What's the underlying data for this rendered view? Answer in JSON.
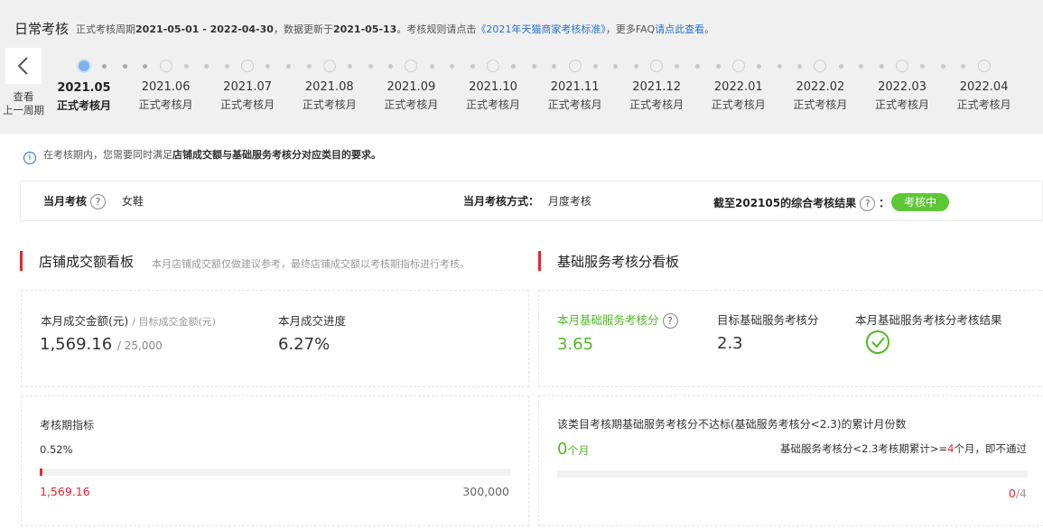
{
  "header": {
    "title": "日常考核",
    "period_prefix": "正式考核周期",
    "period": "2021-05-01 - 2022-04-30",
    "updated_prefix": "，数据更新于",
    "updated": "2021-05-13",
    "rule_prefix": "。考核规则请点击",
    "rule_link": "《2021年天猫商家考核标准》",
    "faq_prefix": "，更多FAQ",
    "faq_link": "请点此查看",
    "faq_suffix": "。"
  },
  "back": {
    "label_line1": "查看",
    "label_line2": "上一周期"
  },
  "timeline": {
    "months": [
      {
        "month": "2021.05",
        "status": "正式考核月",
        "active": true
      },
      {
        "month": "2021.06",
        "status": "正式考核月"
      },
      {
        "month": "2021.07",
        "status": "正式考核月"
      },
      {
        "month": "2021.08",
        "status": "正式考核月"
      },
      {
        "month": "2021.09",
        "status": "正式考核月"
      },
      {
        "month": "2021.10",
        "status": "正式考核月"
      },
      {
        "month": "2021.11",
        "status": "正式考核月"
      },
      {
        "month": "2021.12",
        "status": "正式考核月"
      },
      {
        "month": "2022.01",
        "status": "正式考核月"
      },
      {
        "month": "2022.02",
        "status": "正式考核月"
      },
      {
        "month": "2022.03",
        "status": "正式考核月"
      },
      {
        "month": "2022.04",
        "status": "正式考核月"
      }
    ]
  },
  "notice": {
    "prefix": "在考核期内，您需要同时满足",
    "bold": "店铺成交额与基础服务考核分对应类目的要求。"
  },
  "summary": {
    "month_assess_label": "当月考核",
    "category": "女鞋",
    "method_label": "当月考核方式：",
    "method_value": "月度考核",
    "result_label": "截至202105的综合考核结果",
    "result_colon": "：",
    "result_badge": "考核中"
  },
  "left": {
    "title": "店铺成交额看板",
    "note": "本月店铺成交额仅做建议参考，最终店铺成交额以考核期指标进行考核。",
    "amount_label": "本月成交金额(元)",
    "target_label": "/ 目标成交金额(元)",
    "amount": "1,569.16",
    "target": "/ 25,000",
    "progress_label": "本月成交进度",
    "progress": "6.27%",
    "period_label": "考核期指标",
    "period_pct": "0.52%",
    "period_fraction": 0.0052,
    "period_current": "1,569.16",
    "period_target": "300,000"
  },
  "right": {
    "title": "基础服务考核分看板",
    "score_label": "本月基础服务考核分",
    "score": "3.65",
    "target_label": "目标基础服务考核分",
    "target": "2.3",
    "result_label": "本月基础服务考核分考核结果",
    "fail_desc": "该类目考核期基础服务考核分不达标(基础服务考核分<2.3)的累计月份数",
    "fail_count": "0",
    "fail_unit": "个月",
    "rule_prefix": "基础服务考核分<2.3考核期累计>=",
    "rule_num": "4",
    "rule_suffix": "个月，即不通过",
    "fail_fraction": 0,
    "ratio_num": "0",
    "ratio_den": "/4"
  },
  "colors": {
    "accent_red": "#e5262f",
    "success_green": "#52b829",
    "link_blue": "#2672cf"
  },
  "icons": {
    "back": "chevron-left-icon",
    "info": "info-icon",
    "help": "question-icon",
    "result": "check-circle-icon"
  }
}
